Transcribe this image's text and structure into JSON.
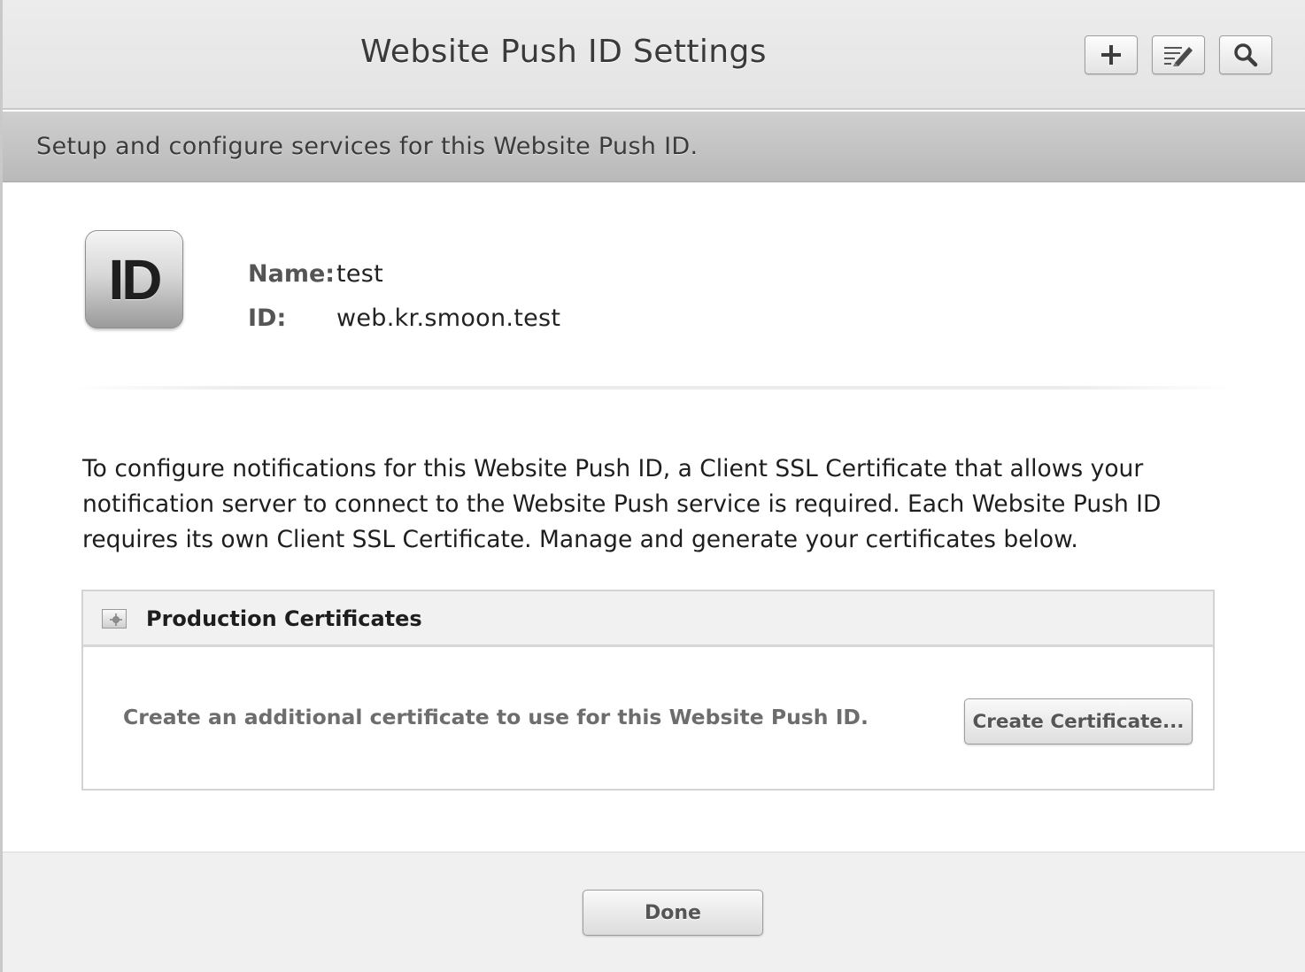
{
  "header": {
    "title": "Website Push ID Settings",
    "toolbar": [
      {
        "name": "add",
        "icon": "plus-icon"
      },
      {
        "name": "edit",
        "icon": "edit-icon"
      },
      {
        "name": "search",
        "icon": "search-icon"
      }
    ]
  },
  "subheader": {
    "text": "Setup and configure services for this Website Push ID."
  },
  "identity": {
    "icon_text": "ID",
    "name_label": "Name:",
    "name_value": "test",
    "id_label": "ID:",
    "id_value": "web.kr.smoon.test"
  },
  "description": "To configure notifications for this Website Push ID, a Client SSL Certificate that allows your notification server to connect to the Website Push service is required. Each Website Push ID requires its own Client SSL Certificate. Manage and generate your certificates below.",
  "certificates": {
    "section_title": "Production Certificates",
    "section_icon": "certificate-icon",
    "create_text": "Create an additional certificate to use for this Website Push ID.",
    "create_button": "Create Certificate..."
  },
  "footer": {
    "done_button": "Done"
  }
}
